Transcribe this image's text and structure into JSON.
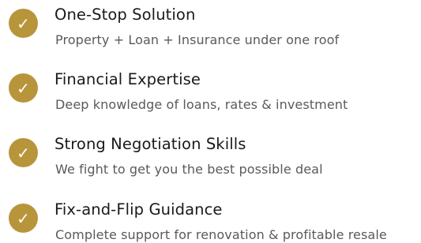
{
  "colors": {
    "accent": "#B8953A",
    "title": "#1a1a1a",
    "description": "#5a5a5a"
  },
  "features": [
    {
      "icon": "check-circle-icon",
      "title": "One-Stop Solution",
      "description": "Property + Loan + Insurance under one roof"
    },
    {
      "icon": "check-circle-icon",
      "title": "Financial Expertise",
      "description": "Deep knowledge of loans, rates & investment"
    },
    {
      "icon": "check-circle-icon",
      "title": "Strong Negotiation Skills",
      "description": "We fight to get you the best possible deal"
    },
    {
      "icon": "check-circle-icon",
      "title": "Fix-and-Flip Guidance",
      "description": "Complete support for renovation & profitable resale"
    }
  ]
}
